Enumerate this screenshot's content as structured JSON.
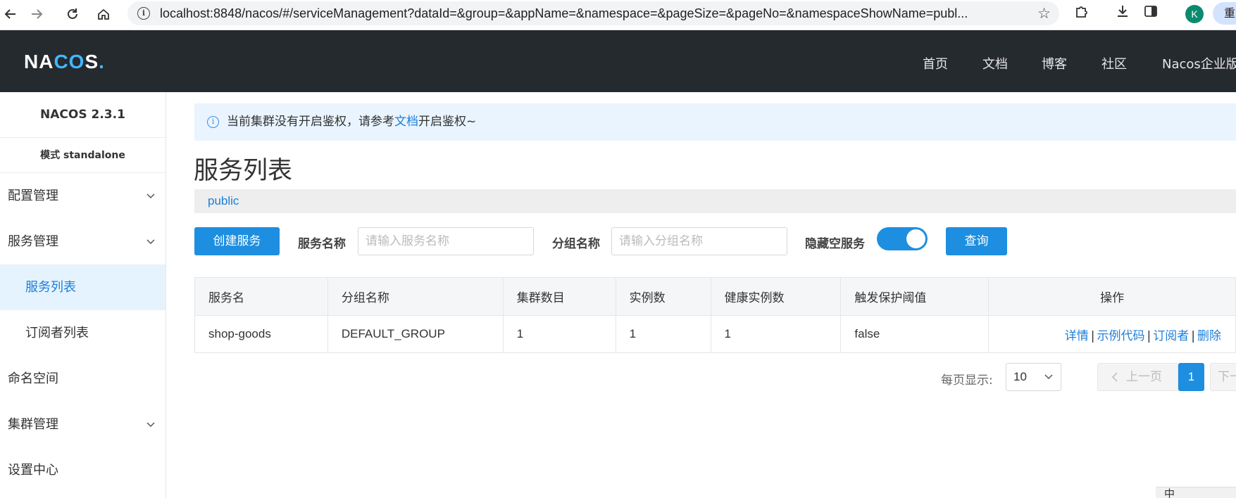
{
  "browser": {
    "url": "localhost:8848/nacos/#/serviceManagement?dataId=&group=&appName=&namespace=&pageSize=&pageNo=&namespaceShowName=publ...",
    "avatar_letter": "K",
    "update_label": "重",
    "icons": [
      "back-arrow-icon",
      "forward-arrow-icon",
      "reload-icon",
      "home-icon",
      "site-info-icon",
      "bookmark-star-icon",
      "extensions-icon",
      "download-icon",
      "sidepanel-icon"
    ]
  },
  "header": {
    "logo": {
      "pre": "NA",
      "co": "CO",
      "post": "S",
      "dot": "."
    },
    "nav": [
      "首页",
      "文档",
      "博客",
      "社区",
      "Nacos企业版"
    ]
  },
  "sidebar": {
    "version": "NACOS 2.3.1",
    "mode": "模式 standalone",
    "items": [
      {
        "label": "配置管理"
      },
      {
        "label": "服务管理"
      },
      {
        "label": "服务列表"
      },
      {
        "label": "订阅者列表"
      },
      {
        "label": "命名空间"
      },
      {
        "label": "集群管理"
      },
      {
        "label": "设置中心"
      }
    ]
  },
  "notice": {
    "before": "当前集群没有开启鉴权，请参考",
    "link": "文档",
    "after": "开启鉴权~"
  },
  "page": {
    "title": "服务列表",
    "namespace": "public"
  },
  "filters": {
    "create_button": "创建服务",
    "service_name_label": "服务名称",
    "service_name_placeholder": "请输入服务名称",
    "group_name_label": "分组名称",
    "group_name_placeholder": "请输入分组名称",
    "hide_empty_label": "隐藏空服务",
    "hide_empty_on": true,
    "query_button": "查询"
  },
  "table": {
    "headers": [
      "服务名",
      "分组名称",
      "集群数目",
      "实例数",
      "健康实例数",
      "触发保护阈值",
      "操作"
    ],
    "rows": [
      {
        "service": "shop-goods",
        "group": "DEFAULT_GROUP",
        "clusters": "1",
        "instances": "1",
        "healthy": "1",
        "threshold": "false",
        "actions": [
          "详情",
          "示例代码",
          "订阅者",
          "删除"
        ]
      }
    ]
  },
  "pagination": {
    "per_page_label": "每页显示:",
    "per_page_value": "10",
    "prev": "上一页",
    "current": "1",
    "next": "下一页"
  },
  "corner_widget": "中"
}
